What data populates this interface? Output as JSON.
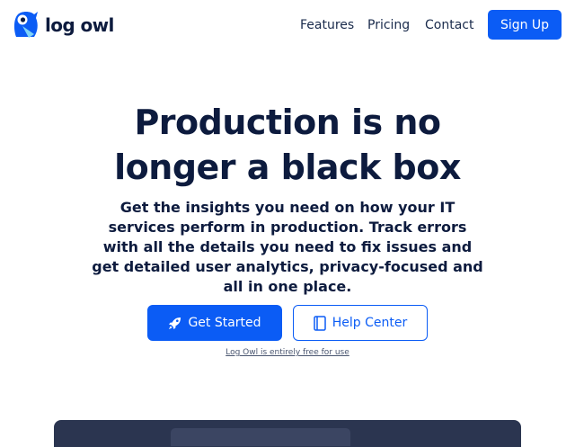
{
  "brand": {
    "name": "log owl",
    "color": "#0b5cf5",
    "icon": "owl-logo-icon"
  },
  "nav": {
    "links": [
      "Features",
      "Pricing",
      "Contact"
    ],
    "signup_label": "Sign Up"
  },
  "hero": {
    "headline_line1": "Production is no",
    "headline_line2": "longer a black box",
    "subtext": "Get the insights you need on how your IT services perform in production. Track errors with all the details you need to fix issues and get detailed user analytics, privacy-focused and all in one place.",
    "primary_cta": {
      "label": "Get Started",
      "icon": "rocket-icon"
    },
    "secondary_cta": {
      "label": "Help Center",
      "icon": "book-icon"
    },
    "free_note": "Log Owl is entirely free for use"
  },
  "colors": {
    "primary": "#0b5cf5",
    "text": "#0d1b3e",
    "preview_bg": "#2b3550"
  }
}
